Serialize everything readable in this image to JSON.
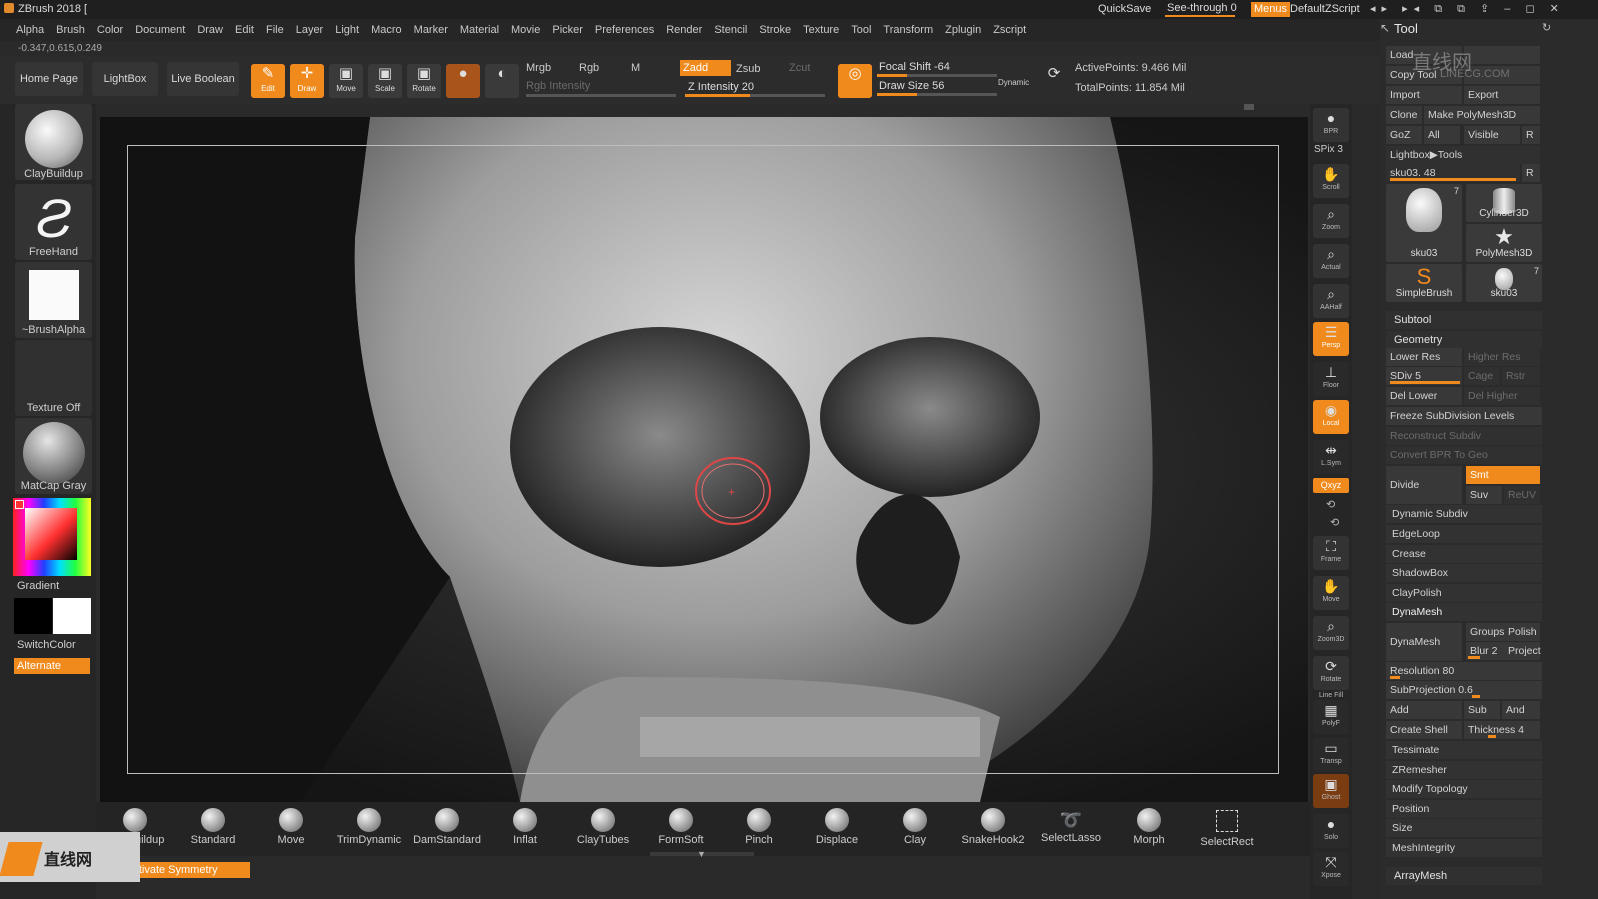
{
  "titlebar": {
    "title": "ZBrush 2018 [",
    "quicksave": "QuickSave",
    "seethrough": "See-through",
    "seethrough_value": "0",
    "menus": "Menus",
    "script": "DefaultZScript"
  },
  "menubar": {
    "items": [
      "Alpha",
      "Brush",
      "Color",
      "Document",
      "Draw",
      "Edit",
      "File",
      "Layer",
      "Light",
      "Macro",
      "Marker",
      "Material",
      "Movie",
      "Picker",
      "Preferences",
      "Render",
      "Stencil",
      "Stroke",
      "Texture",
      "Tool",
      "Transform",
      "Zplugin",
      "Zscript"
    ]
  },
  "coords": "-0.347,0.615,0.249",
  "shelf": {
    "home_page": "Home Page",
    "lightbox": "LightBox",
    "live_boolean": "Live Boolean",
    "edit": "Edit",
    "draw": "Draw",
    "move": "Move",
    "scale": "Scale",
    "rotate": "Rotate",
    "mrgb": "Mrgb",
    "rgb": "Rgb",
    "m": "M",
    "rgb_intensity": "Rgb Intensity",
    "zadd": "Zadd",
    "zsub": "Zsub",
    "zcut": "Zcut",
    "z_intensity": "Z Intensity 20",
    "focal_shift": "Focal Shift -64",
    "draw_size": "Draw Size 56",
    "dynamic": "Dynamic",
    "active_points": "ActivePoints: 9.466 Mil",
    "total_points": "TotalPoints: 11.854 Mil"
  },
  "leftpanel": {
    "claybuildup": "ClayBuildup",
    "freehand": "FreeHand",
    "brushalpha": "~BrushAlpha",
    "texture_off": "Texture Off",
    "matcap": "MatCap Gray",
    "gradient": "Gradient",
    "switchcolor": "SwitchColor",
    "alternate": "Alternate"
  },
  "rightstrip": {
    "bpr": "BPR",
    "spix": "SPix 3",
    "scroll": "Scroll",
    "zoom": "Zoom",
    "actual": "Actual",
    "aahalf": "AAHalf",
    "persp": "Persp",
    "floor": "Floor",
    "local": "Local",
    "lsym": "L.Sym",
    "xyz": "Qxyz",
    "frame": "Frame",
    "move": "Move",
    "zoom3d": "Zoom3D",
    "rotate": "Rotate",
    "linefill": "Line Fill",
    "polyf": "PolyF",
    "transp": "Transp",
    "ghost": "Ghost",
    "solo": "Solo",
    "xpose": "Xpose"
  },
  "toolpanel": {
    "title": "Tool",
    "load": "Load",
    "copy_tool": "Copy Tool",
    "import": "Import",
    "export": "Export",
    "clone": "Clone",
    "make_polymesh": "Make PolyMesh3D",
    "goz": "GoZ",
    "all": "All",
    "visible": "Visible",
    "r": "R",
    "lightbox_tools": "Lightbox▶Tools",
    "current_tool": "sku03. 48",
    "thumbs": [
      {
        "label": "sku03",
        "count": "7"
      },
      {
        "label": "Cylinder3D",
        "count": ""
      },
      {
        "label": "PolyMesh3D",
        "count": ""
      },
      {
        "label": "SimpleBrush",
        "count": ""
      },
      {
        "label": "sku03",
        "count": "7"
      }
    ],
    "subtool": "Subtool",
    "geometry": "Geometry",
    "lower_res": "Lower Res",
    "higher_res": "Higher Res",
    "sdiv": "SDiv 5",
    "cage": "Cage",
    "rstr": "Rstr",
    "del_lower": "Del Lower",
    "del_higher": "Del Higher",
    "freeze": "Freeze SubDivision Levels",
    "reconstruct": "Reconstruct Subdiv",
    "convert_bpr": "Convert BPR To Geo",
    "divide": "Divide",
    "smt": "Smt",
    "suv": "Suv",
    "reuv": "ReUV",
    "dynamic_subdiv": "Dynamic Subdiv",
    "edgeloop": "EdgeLoop",
    "crease": "Crease",
    "shadowbox": "ShadowBox",
    "claypolish": "ClayPolish",
    "dynamesh_head": "DynaMesh",
    "dynamesh_btn": "DynaMesh",
    "groups": "Groups",
    "polish": "Polish",
    "blur": "Blur 2",
    "project": "Project",
    "resolution": "Resolution 80",
    "subprojection": "SubProjection 0.6",
    "add": "Add",
    "sub": "Sub",
    "and": "And",
    "create_shell": "Create Shell",
    "thickness": "Thickness 4",
    "tessimate": "Tessimate",
    "zremesher": "ZRemesher",
    "modify_topology": "Modify Topology",
    "position": "Position",
    "size": "Size",
    "meshintegrity": "MeshIntegrity",
    "arraymesh": "ArrayMesh"
  },
  "brushes": [
    "ClayBuildup",
    "Standard",
    "Move",
    "TrimDynamic",
    "DamStandard",
    "Inflat",
    "ClayTubes",
    "FormSoft",
    "Pinch",
    "Displace",
    "Clay",
    "SnakeHook2",
    "SelectLasso",
    "Morph",
    "SelectRect"
  ],
  "bottom": {
    "symmetry": "Activate Symmetry"
  },
  "watermark": {
    "cn": "直线网",
    "en": "LINECG.COM"
  }
}
